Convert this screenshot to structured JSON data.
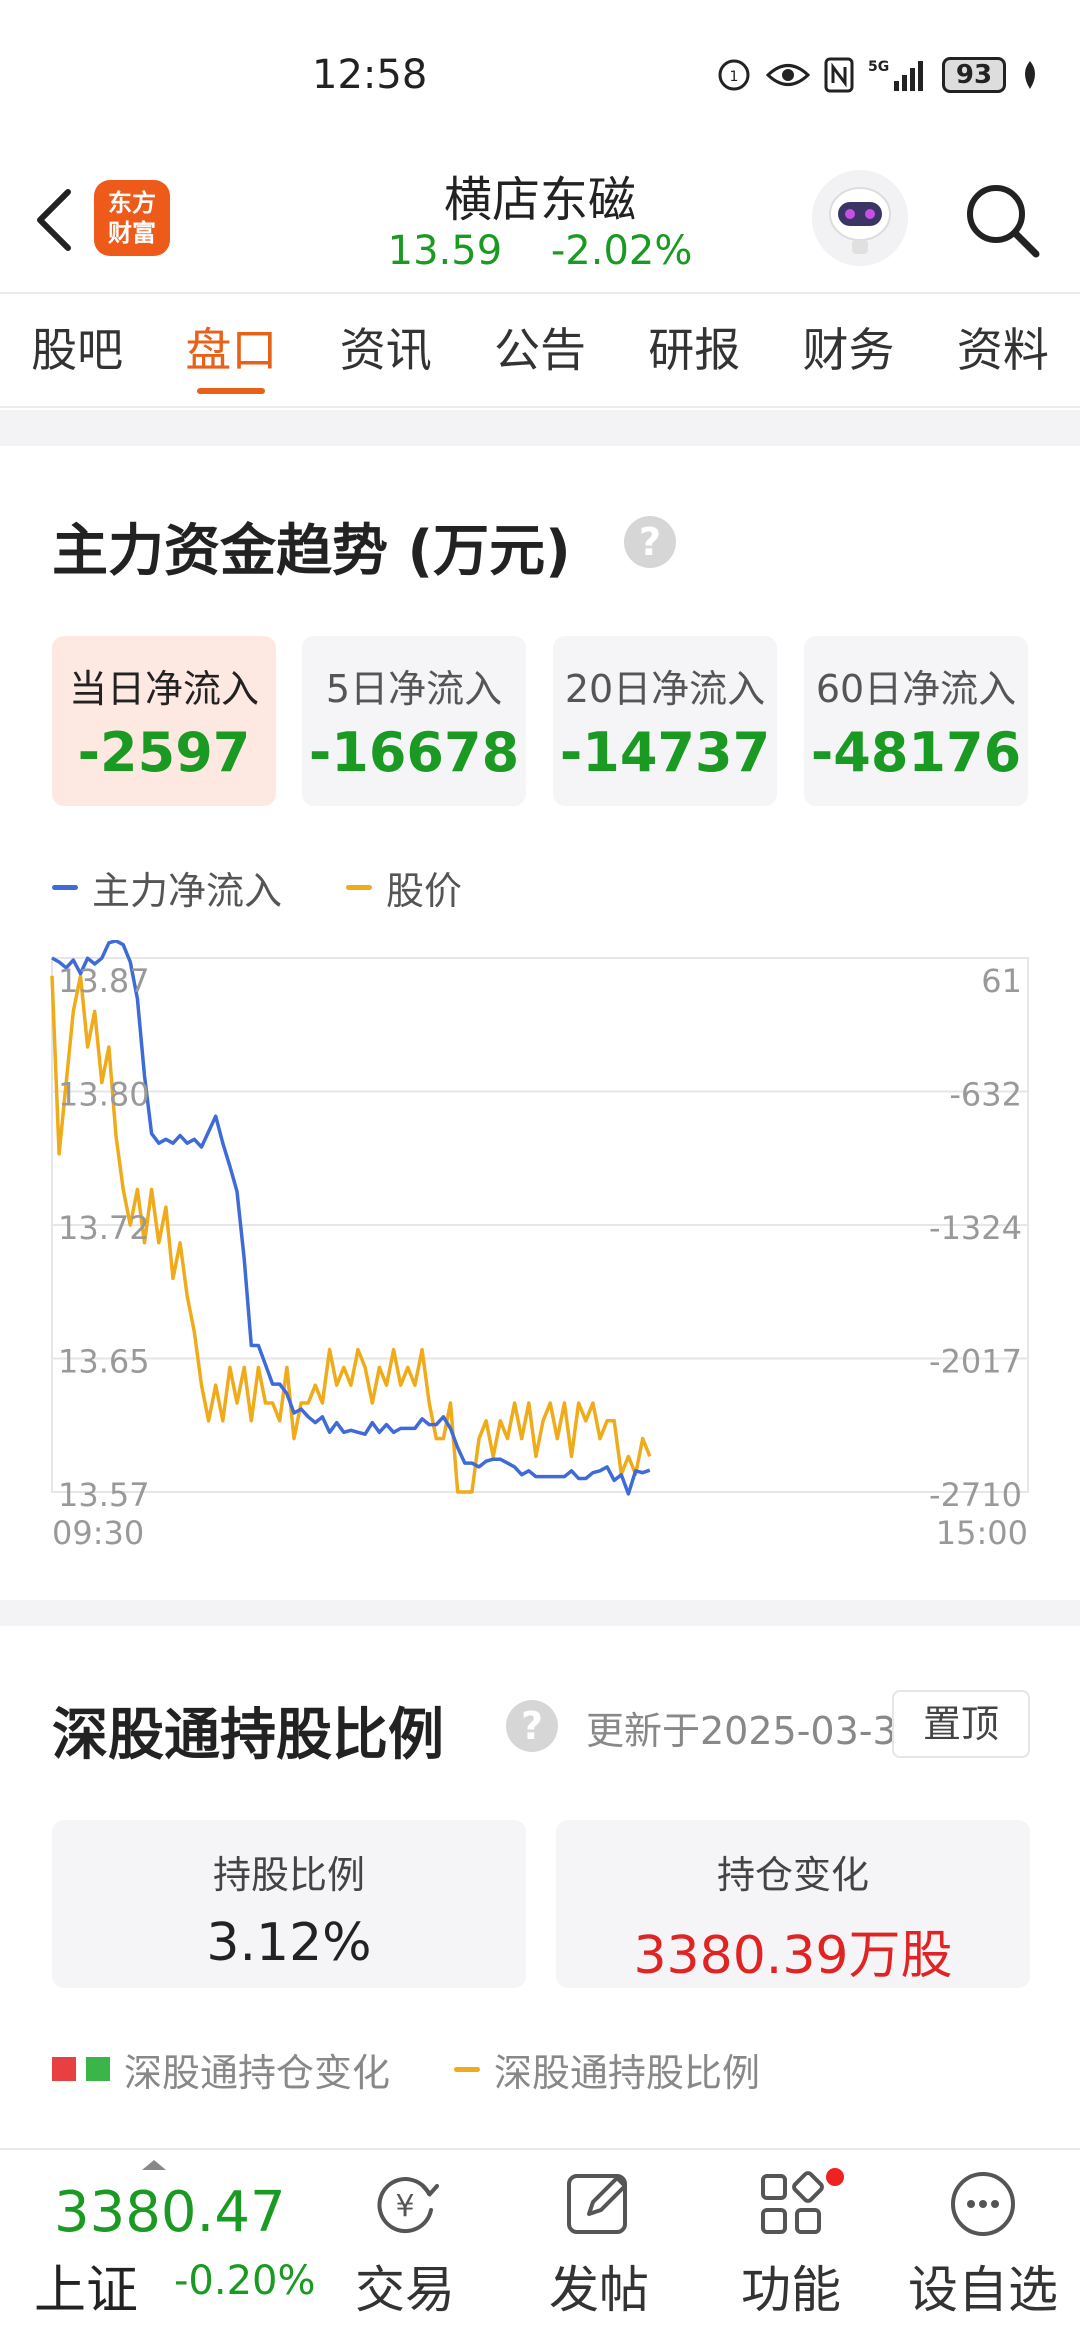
{
  "status_bar": {
    "time": "12:58",
    "battery": "93"
  },
  "header": {
    "logo_line1": "东方",
    "logo_line2": "财富",
    "stock_name": "横店东磁",
    "price": "13.59",
    "change_pct": "-2.02%"
  },
  "tabs": [
    {
      "label": "股吧"
    },
    {
      "label": "盘口",
      "active": true
    },
    {
      "label": "资讯"
    },
    {
      "label": "公告"
    },
    {
      "label": "研报"
    },
    {
      "label": "财务"
    },
    {
      "label": "资料"
    }
  ],
  "capital_flow": {
    "title": "主力资金趋势 (万元)",
    "help_symbol": "?",
    "boxes": [
      {
        "label": "当日净流入",
        "value": "-2597"
      },
      {
        "label": "5日净流入",
        "value": "-16678"
      },
      {
        "label": "20日净流入",
        "value": "-14737"
      },
      {
        "label": "60日净流入",
        "value": "-48176"
      }
    ],
    "legend": {
      "flow": "主力净流入",
      "price": "股价"
    }
  },
  "chart_data": {
    "type": "line",
    "x_start": "09:30",
    "x_end": "15:00",
    "left_axis_ticks": [
      "13.87",
      "13.80",
      "13.72",
      "13.65",
      "13.57"
    ],
    "right_axis_ticks": [
      "61",
      "-632",
      "-1324",
      "-2017",
      "-2710"
    ],
    "left_ylim": [
      13.57,
      13.87
    ],
    "right_ylim": [
      -2710,
      61
    ],
    "grid": true,
    "series": [
      {
        "name": "主力净流入",
        "color": "#3f6bd8",
        "axis": "right",
        "values": [
          61,
          40,
          10,
          50,
          -20,
          60,
          30,
          60,
          140,
          150,
          130,
          40,
          -150,
          -550,
          -850,
          -900,
          -880,
          -900,
          -860,
          -900,
          -880,
          -920,
          -840,
          -760,
          -900,
          -1020,
          -1150,
          -1500,
          -1950,
          -1950,
          -2050,
          -2150,
          -2150,
          -2200,
          -2300,
          -2280,
          -2320,
          -2350,
          -2320,
          -2400,
          -2350,
          -2400,
          -2390,
          -2400,
          -2410,
          -2350,
          -2400,
          -2360,
          -2400,
          -2380,
          -2380,
          -2380,
          -2330,
          -2360,
          -2360,
          -2320,
          -2380,
          -2480,
          -2560,
          -2560,
          -2580,
          -2550,
          -2540,
          -2540,
          -2560,
          -2580,
          -2620,
          -2600,
          -2630,
          -2630,
          -2630,
          -2630,
          -2630,
          -2600,
          -2640,
          -2640,
          -2610,
          -2600,
          -2580,
          -2650,
          -2620,
          -2720,
          -2600,
          -2610,
          -2597
        ]
      },
      {
        "name": "股价",
        "color": "#f0ab1a",
        "axis": "left",
        "values": [
          13.86,
          13.76,
          13.8,
          13.84,
          13.86,
          13.82,
          13.84,
          13.8,
          13.82,
          13.77,
          13.74,
          13.72,
          13.74,
          13.71,
          13.74,
          13.71,
          13.73,
          13.69,
          13.71,
          13.68,
          13.66,
          13.63,
          13.61,
          13.63,
          13.61,
          13.64,
          13.62,
          13.64,
          13.61,
          13.64,
          13.62,
          13.62,
          13.61,
          13.64,
          13.6,
          13.62,
          13.62,
          13.63,
          13.62,
          13.65,
          13.63,
          13.64,
          13.63,
          13.65,
          13.64,
          13.62,
          13.64,
          13.63,
          13.65,
          13.63,
          13.64,
          13.63,
          13.65,
          13.62,
          13.6,
          13.6,
          13.62,
          13.57,
          13.57,
          13.57,
          13.6,
          13.61,
          13.59,
          13.61,
          13.6,
          13.62,
          13.6,
          13.62,
          13.59,
          13.61,
          13.62,
          13.6,
          13.62,
          13.59,
          13.62,
          13.61,
          13.62,
          13.6,
          13.61,
          13.61,
          13.58,
          13.59,
          13.58,
          13.6,
          13.59
        ]
      }
    ]
  },
  "shenzhen_connect": {
    "title": "深股通持股比例",
    "help_symbol": "?",
    "update_text": "更新于2025-03-3",
    "pin_label": "置顶",
    "boxes": [
      {
        "label": "持股比例",
        "value": "3.12%"
      },
      {
        "label": "持仓变化",
        "value": "3380.39万股"
      }
    ],
    "legend": {
      "change": "深股通持仓变化",
      "ratio": "深股通持股比例"
    }
  },
  "bottom_nav": {
    "index_value": "3380.47",
    "index_name": "上证",
    "index_pct": "-0.20%",
    "items": [
      {
        "label": "交易"
      },
      {
        "label": "发帖"
      },
      {
        "label": "功能"
      },
      {
        "label": "设自选"
      }
    ]
  }
}
